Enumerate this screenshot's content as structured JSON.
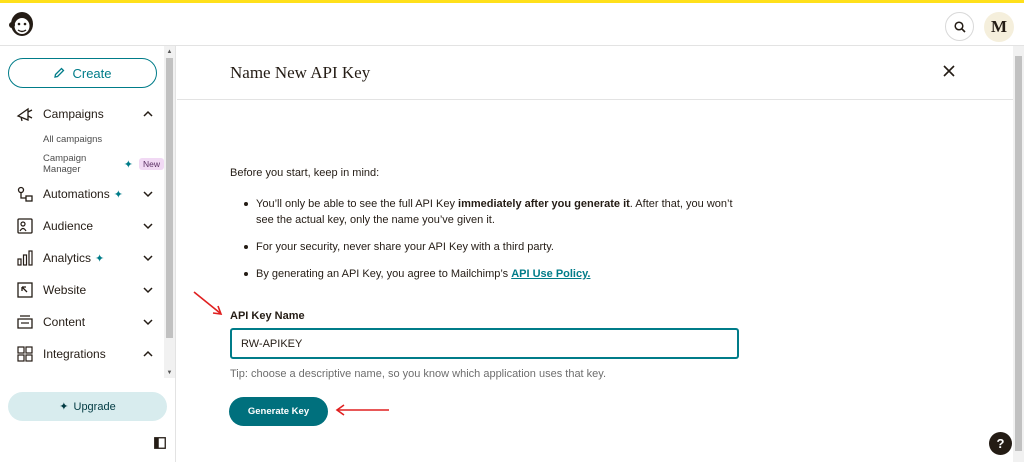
{
  "header": {
    "logo_icon": "mailchimp-logo",
    "search_icon": "search-icon",
    "avatar_initial": "M"
  },
  "sidebar": {
    "create_label": "Create",
    "nav": [
      {
        "label": "Campaigns",
        "icon": "megaphone-icon",
        "expanded": true
      },
      {
        "label": "Automations",
        "icon": "automation-icon",
        "sparkle": true
      },
      {
        "label": "Audience",
        "icon": "audience-icon"
      },
      {
        "label": "Analytics",
        "icon": "bar-chart-icon",
        "sparkle": true
      },
      {
        "label": "Website",
        "icon": "website-icon"
      },
      {
        "label": "Content",
        "icon": "content-icon"
      },
      {
        "label": "Integrations",
        "icon": "grid-icon",
        "expanded": true
      }
    ],
    "campaign_sub": [
      {
        "label": "All campaigns"
      },
      {
        "label": "Campaign Manager",
        "sparkle": true,
        "badge": "New"
      }
    ],
    "upgrade_label": "Upgrade"
  },
  "panel": {
    "title": "Name New API Key",
    "intro": "Before you start, keep in mind:",
    "bullet1_pre": "You’ll only be able to see the full API Key ",
    "bullet1_bold": "immediately after you generate it",
    "bullet1_post": ". After that, you won’t see the actual key, only the name you’ve given it.",
    "bullet2": "For your security, never share your API Key with a third party.",
    "bullet3_pre": "By generating an API Key, you agree to Mailchimp’s ",
    "bullet3_link": "API Use Policy.",
    "field_label": "API Key Name",
    "field_value": "RW-APIKEY",
    "tip": "Tip: choose a descriptive name, so you know which application uses that key.",
    "generate_label": "Generate Key"
  },
  "help_label": "?",
  "colors": {
    "accent": "#007c89",
    "brand_yellow": "#ffe01b",
    "annotation_red": "#e02020"
  }
}
